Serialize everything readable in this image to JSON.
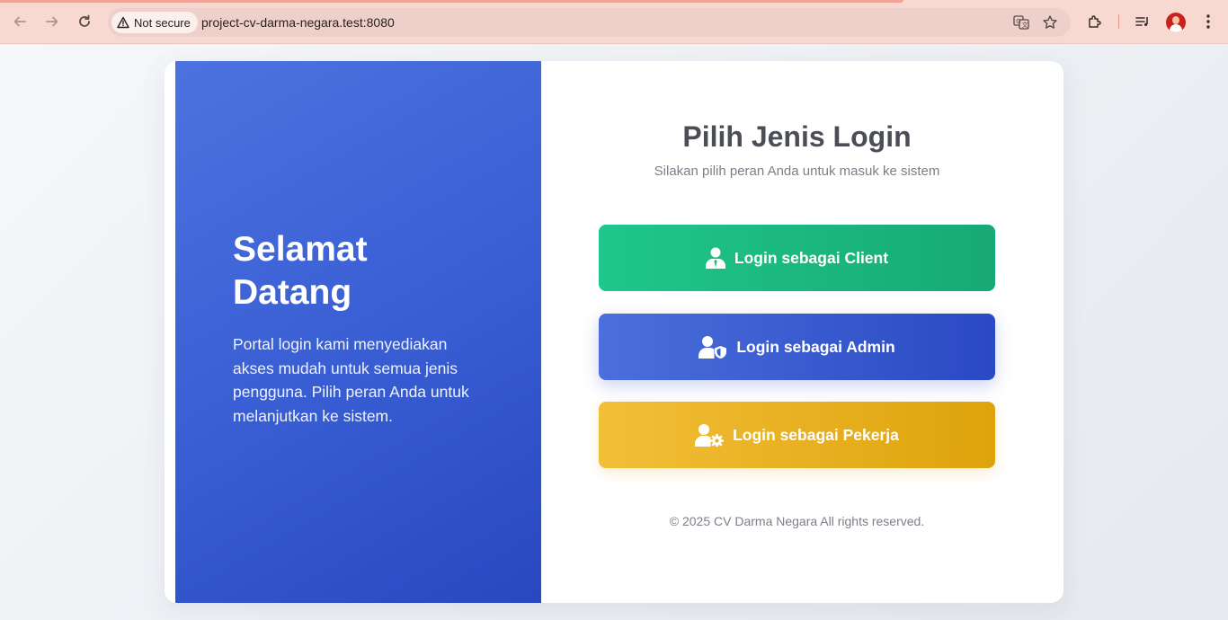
{
  "browser": {
    "security_label": "Not secure",
    "url": "project-cv-darma-negara.test:8080"
  },
  "page": {
    "welcome_title": "Selamat Datang",
    "welcome_description": "Portal login kami menyediakan akses mudah untuk semua jenis pengguna. Pilih peran Anda untuk melanjutkan ke sistem.",
    "title": "Pilih Jenis Login",
    "subtitle": "Silakan pilih peran Anda untuk masuk ke sistem",
    "buttons": {
      "client": "Login sebagai Client",
      "admin": "Login sebagai Admin",
      "pekerja": "Login sebagai Pekerja"
    },
    "footer": "© 2025 CV Darma Negara All rights reserved."
  },
  "colors": {
    "client": "#1fc78a",
    "admin": "#3a5fd4",
    "pekerja": "#f2bf38",
    "left_panel": "#3a5fd4"
  },
  "icons": {
    "client": "user-tie-icon",
    "admin": "user-shield-icon",
    "pekerja": "user-gear-icon"
  }
}
